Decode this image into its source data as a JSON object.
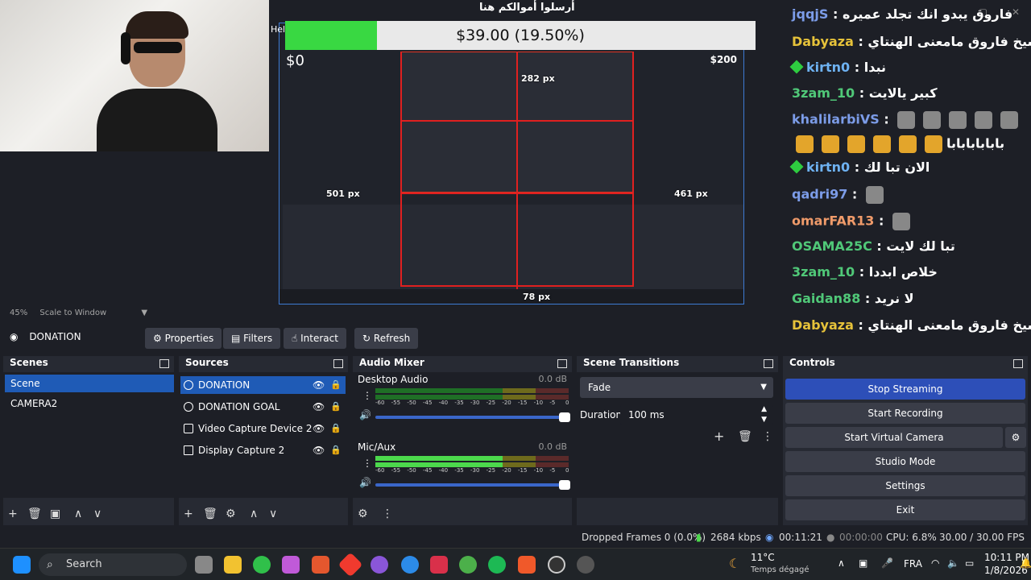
{
  "preview": {
    "donation_title": "أرسلوا أموالكم هنا",
    "donation_amount": "$39.00 (19.50%)",
    "donation_progress": 0.195,
    "goal_min_label": "Hel",
    "capture_min": "$0",
    "capture_max": "$200",
    "px_labels": [
      "501 px",
      "282 px",
      "461 px",
      "78 px"
    ]
  },
  "chat": {
    "messages": [
      {
        "user": "jqqjS",
        "color": "#7c9ce8",
        "text": "فاروق يبدو انك تجلد عميره"
      },
      {
        "user": "Dabyaza",
        "color": "#e6c23a",
        "text": "يا شيخ فاروق مامعنى الهنتاي"
      },
      {
        "user": "kirtn0",
        "color": "#6eb2f2",
        "text": "نبدا"
      },
      {
        "user": "3zam_10",
        "color": "#50c878",
        "text": "كبير يالايت"
      },
      {
        "user": "khalilarbiVS",
        "color": "#7c9ce8",
        "text": "بابابابابابا"
      },
      {
        "user": "kirtn0",
        "color": "#6eb2f2",
        "text": "الان تبا لك"
      },
      {
        "user": "qadri97",
        "color": "#7c9ce8",
        "text": ""
      },
      {
        "user": "omarFAR13",
        "color": "#f09b6a",
        "text": ""
      },
      {
        "user": "OSAMA25C",
        "color": "#50c878",
        "text": "تبا لك لايت"
      },
      {
        "user": "3zam_10",
        "color": "#50c878",
        "text": "خلاص ابددا"
      },
      {
        "user": "Gaidan88",
        "color": "#50c878",
        "text": "لا نريد"
      },
      {
        "user": "Dabyaza",
        "color": "#e6c23a",
        "text": "يا شيخ فاروق مامعنى الهنتاي"
      }
    ]
  },
  "scale": {
    "zoom": "45%",
    "mode": "Scale to Window"
  },
  "source_toolbar": {
    "source_name": "DONATION",
    "properties": "Properties",
    "filters": "Filters",
    "interact": "Interact",
    "refresh": "Refresh"
  },
  "scenes": {
    "title": "Scenes",
    "items": [
      "Scene",
      "CAMERA2"
    ]
  },
  "sources": {
    "title": "Sources",
    "items": [
      "DONATION",
      "DONATION GOAL",
      "Video Capture Device 2",
      "Display Capture 2"
    ]
  },
  "mixer": {
    "title": "Audio Mixer",
    "channels": [
      {
        "name": "Desktop Audio",
        "db": "0.0 dB",
        "level": 0
      },
      {
        "name": "Mic/Aux",
        "db": "0.0 dB",
        "level": 0.66
      }
    ],
    "ticks": [
      "-60",
      "-55",
      "-50",
      "-45",
      "-40",
      "-35",
      "-30",
      "-25",
      "-20",
      "-15",
      "-10",
      "-5",
      "0"
    ]
  },
  "transitions": {
    "title": "Scene Transitions",
    "selected": "Fade",
    "duration_label": "Duration",
    "duration_value": "100 ms"
  },
  "controls": {
    "title": "Controls",
    "buttons": [
      "Stop Streaming",
      "Start Recording",
      "Start Virtual Camera",
      "Studio Mode",
      "Settings",
      "Exit"
    ]
  },
  "status": {
    "dropped": "Dropped Frames 0 (0.0%)",
    "bitrate": "2684 kbps",
    "stream_time": "00:11:21",
    "rec_time": "00:00:00",
    "cpu": "CPU: 6.8%",
    "fps": "30.00 / 30.00 FPS"
  },
  "taskbar": {
    "search": "Search",
    "weather_temp": "11°C",
    "weather_desc": "Temps dégagé",
    "lang": "FRA",
    "time": "10:11 PM",
    "date": "1/8/2026"
  }
}
